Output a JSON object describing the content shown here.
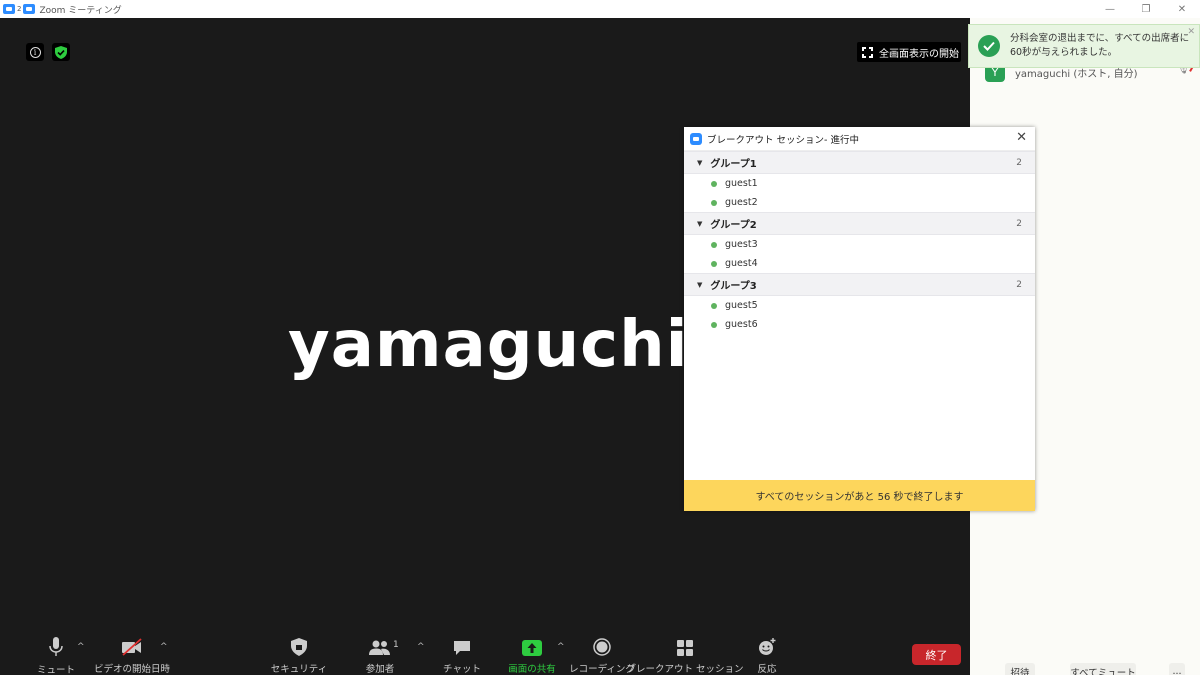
{
  "window": {
    "badge_count": "2",
    "title": "Zoom ミーティング"
  },
  "video": {
    "fullscreen_label": "全画面表示の開始",
    "speaker_name": "yamaguchi"
  },
  "toolbar": {
    "mute": "ミュート",
    "start_video": "ビデオの開始日時",
    "security": "セキュリティ",
    "participants": "参加者",
    "participants_count": "1",
    "chat": "チャット",
    "share_screen": "画面の共有",
    "recording": "レコーディング",
    "breakout": "ブレークアウト セッション",
    "reactions": "反応",
    "end": "終了"
  },
  "right_panel": {
    "participant_initial": "Y",
    "participant_name": "yamaguchi (ホスト, 自分)",
    "invite": "招待",
    "mute_all": "すべてミュート",
    "more": "..."
  },
  "toast": {
    "message": "分科会室の退出までに、すべての出席者に60秒が与えられました。"
  },
  "breakout_dialog": {
    "title": "ブレークアウト セッション- 進行中",
    "groups": [
      {
        "name": "グループ1",
        "count": "2",
        "members": [
          "guest1",
          "guest2"
        ]
      },
      {
        "name": "グループ2",
        "count": "2",
        "members": [
          "guest3",
          "guest4"
        ]
      },
      {
        "name": "グループ3",
        "count": "2",
        "members": [
          "guest5",
          "guest6"
        ]
      }
    ],
    "footer": "すべてのセッションがあと 56 秒で終了します"
  },
  "colors": {
    "accent_blue": "#2d8cff",
    "end_red": "#c8262b",
    "share_green": "#2ecc40",
    "footer_yellow": "#fdd65c",
    "toast_green": "#2aa055"
  }
}
